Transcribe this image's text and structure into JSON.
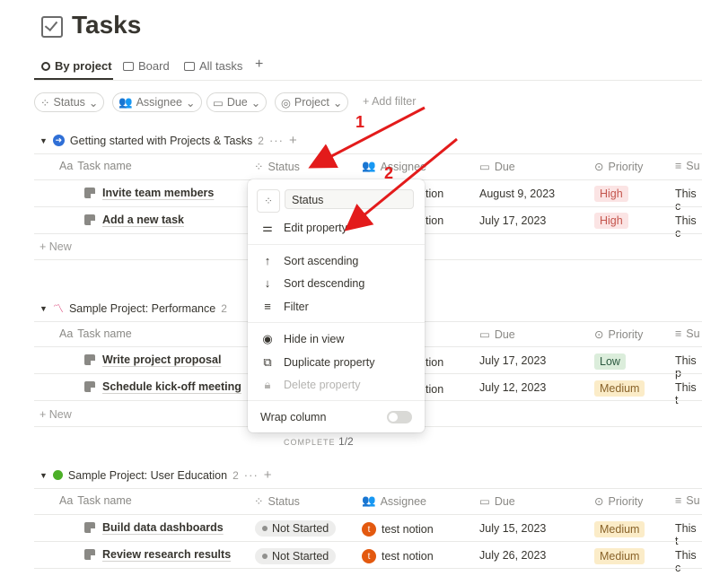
{
  "page": {
    "title": "Tasks"
  },
  "views": [
    {
      "label": "By project",
      "icon": "target-icon"
    },
    {
      "label": "Board",
      "icon": "board-icon"
    },
    {
      "label": "All tasks",
      "icon": "table-icon"
    },
    {
      "label": "+",
      "icon": "plus-icon"
    }
  ],
  "filters": {
    "status": "Status",
    "assignee": "Assignee",
    "due": "Due",
    "project": "Project",
    "add": "+ Add filter"
  },
  "columns": {
    "task": "Task name",
    "task_prefix": "Aa",
    "status": "Status",
    "assignee": "Assignee",
    "due": "Due",
    "priority": "Priority",
    "summary": "Su"
  },
  "groups": [
    {
      "name": "Getting started with Projects & Tasks",
      "count": "2",
      "icon": "arrow-circle-icon",
      "rows": [
        {
          "task": "Invite team members",
          "assignee": "tion",
          "due": "August 9, 2023",
          "priority": "High",
          "summary": "This c"
        },
        {
          "task": "Add a new task",
          "assignee": "tion",
          "due": "July 17, 2023",
          "priority": "High",
          "summary": "This c"
        }
      ],
      "new_label": "+ New"
    },
    {
      "name": "Sample Project: Performance",
      "count": "2",
      "icon": "chart-icon",
      "rows": [
        {
          "task": "Write project proposal",
          "assignee": "tion",
          "due": "July 17, 2023",
          "priority": "Low",
          "summary": "This p"
        },
        {
          "task": "Schedule kick-off meeting",
          "assignee": "tion",
          "due": "July 12, 2023",
          "priority": "Medium",
          "summary": "This t"
        }
      ],
      "new_label": "+ New",
      "footer_label": "COMPLETE",
      "footer_value": "1/2"
    },
    {
      "name": "Sample Project: User Education",
      "count": "2",
      "icon": "apple-icon",
      "rows": [
        {
          "task": "Build data dashboards",
          "status": "Not Started",
          "assignee": "test notion",
          "avatar": "t",
          "due": "July 15, 2023",
          "priority": "Medium",
          "summary": "This t"
        },
        {
          "task": "Review research results",
          "status": "Not Started",
          "assignee": "test notion",
          "avatar": "t",
          "due": "July 26, 2023",
          "priority": "Medium",
          "summary": "This c"
        }
      ]
    }
  ],
  "popup": {
    "name_value": "Status",
    "edit": "Edit property",
    "sort_asc": "Sort ascending",
    "sort_desc": "Sort descending",
    "filter": "Filter",
    "hide": "Hide in view",
    "duplicate": "Duplicate property",
    "delete": "Delete property",
    "wrap": "Wrap column"
  },
  "annotations": {
    "one": "1",
    "two": "2"
  },
  "colors": {
    "accent_red": "#e31b1b",
    "high_bg": "#fbe4e4",
    "low_bg": "#dbeddb",
    "medium_bg": "#fbecc8"
  }
}
